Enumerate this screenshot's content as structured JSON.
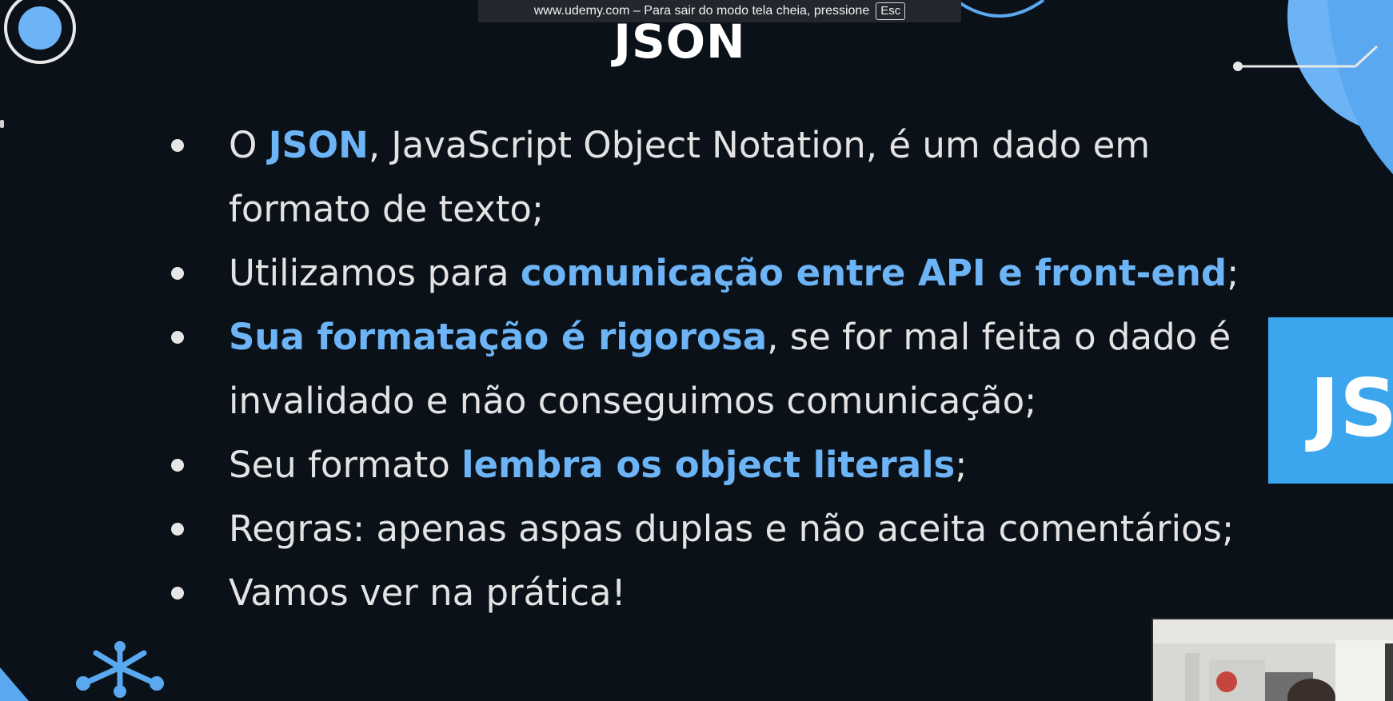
{
  "browser_banner": {
    "message": "www.udemy.com – Para sair do modo tela cheia, pressione",
    "key": "Esc"
  },
  "slide": {
    "title": "JSON",
    "bullets": [
      {
        "parts": [
          {
            "text": "O ",
            "highlight": false
          },
          {
            "text": "JSON",
            "highlight": true
          },
          {
            "text": ", JavaScript Object Notation, é um dado em formato de texto;",
            "highlight": false
          }
        ]
      },
      {
        "parts": [
          {
            "text": "Utilizamos para ",
            "highlight": false
          },
          {
            "text": "comunicação entre API e front-end",
            "highlight": true
          },
          {
            "text": ";",
            "highlight": false
          }
        ]
      },
      {
        "parts": [
          {
            "text": "Sua formatação é rigorosa",
            "highlight": true
          },
          {
            "text": ", se for mal feita o dado é invalidado e não conseguimos comunicação;",
            "highlight": false
          }
        ]
      },
      {
        "parts": [
          {
            "text": "Seu formato ",
            "highlight": false
          },
          {
            "text": "lembra os object literals",
            "highlight": true
          },
          {
            "text": ";",
            "highlight": false
          }
        ]
      },
      {
        "parts": [
          {
            "text": "Regras: apenas aspas duplas e não aceita comentários;",
            "highlight": false
          }
        ]
      },
      {
        "parts": [
          {
            "text": "Vamos ver na prática!",
            "highlight": false
          }
        ]
      }
    ],
    "side_badge_text": "JS"
  },
  "colors": {
    "background": "#0b1118",
    "highlight": "#6cb4f6",
    "accent_blue": "#5aa9f0",
    "badge_blue": "#3ba5ed",
    "text": "#e3e3e3"
  }
}
